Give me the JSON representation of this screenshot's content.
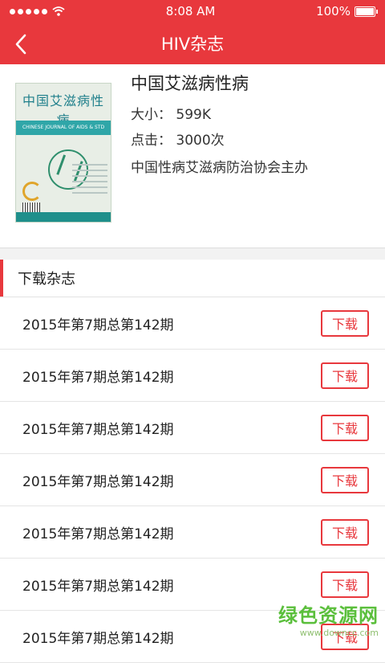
{
  "status_bar": {
    "time": "8:08 AM",
    "battery": "100%",
    "battery_level": 1.0
  },
  "nav": {
    "title": "HIV杂志"
  },
  "magazine": {
    "cover_title": "中国艾滋病性病",
    "cover_subtitle": "CHINESE JOURNAL OF AIDS & STD",
    "title": "中国艾滋病性病",
    "size": "大小：  599K",
    "clicks": "点击：  3000次",
    "publisher": "中国性病艾滋病防治协会主办"
  },
  "section": {
    "title": "下载杂志"
  },
  "issues": [
    {
      "label": "2015年第7期总第142期",
      "action": "下载"
    },
    {
      "label": "2015年第7期总第142期",
      "action": "下载"
    },
    {
      "label": "2015年第7期总第142期",
      "action": "下载"
    },
    {
      "label": "2015年第7期总第142期",
      "action": "下载"
    },
    {
      "label": "2015年第7期总第142期",
      "action": "下载"
    },
    {
      "label": "2015年第7期总第142期",
      "action": "下载"
    },
    {
      "label": "2015年第7期总第142期",
      "action": "下载"
    }
  ],
  "watermark": {
    "main": "绿色资源网",
    "sub": "www.downcc.com"
  },
  "colors": {
    "accent": "#e8383d",
    "watermark": "#5bbf3c"
  }
}
